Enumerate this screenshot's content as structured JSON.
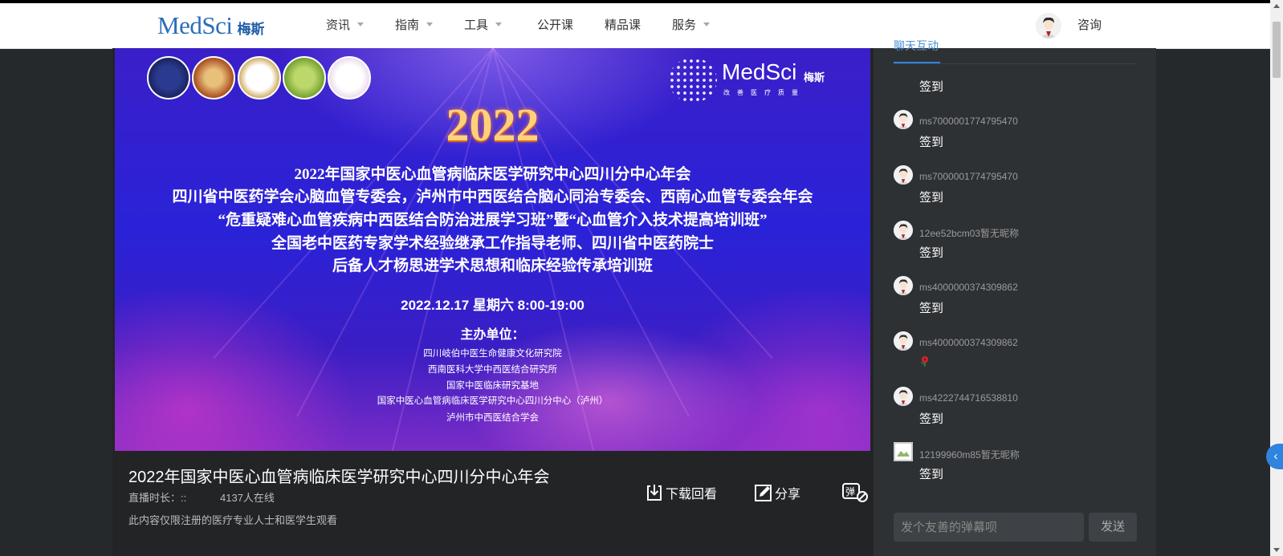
{
  "navbar": {
    "logo_en": "MedSci",
    "logo_zh": "梅斯",
    "items": [
      {
        "label": "资讯",
        "has_dropdown": true
      },
      {
        "label": "指南",
        "has_dropdown": true
      },
      {
        "label": "工具",
        "has_dropdown": true
      },
      {
        "label": "公开课",
        "has_dropdown": false
      },
      {
        "label": "精品课",
        "has_dropdown": false
      },
      {
        "label": "服务",
        "has_dropdown": true
      }
    ],
    "consult_label": "咨询"
  },
  "slide": {
    "brand_en": "MedSci",
    "brand_zh": "梅斯",
    "brand_slogan": "改善医疗质量",
    "year": "2022",
    "lines": [
      "2022年国家中医心血管病临床医学研究中心四川分中心年会",
      "四川省中医药学会心脑血管专委会，泸州市中西医结合脑心同治专委会、西南心血管专委会年会",
      "“危重疑难心血管疾病中西医结合防治进展学习班”暨“心血管介入技术提高培训班”",
      "全国老中医药专家学术经验继承工作指导老师、四川省中医药院士",
      "后备人才杨思进学术思想和临床经验传承培训班"
    ],
    "date": "2022.12.17 星期六 8:00-19:00",
    "host_title": "主办单位：",
    "organizers": [
      "四川岐伯中医生命健康文化研究院",
      "西南医科大学中西医结合研究所",
      "国家中医临床研究基地",
      "国家中医心血管病临床医学研究中心四川分中心（泸州）",
      "泸州市中西医结合学会"
    ]
  },
  "video": {
    "title": "2022年国家中医心血管病临床医学研究中心四川分中心年会",
    "duration_label": "直播时长：::",
    "online_count": "4137人在线",
    "notice": "此内容仅限注册的医疗专业人士和医学生观看",
    "actions": {
      "download": "下载回看",
      "share": "分享"
    }
  },
  "chat": {
    "tab_label": "聊天互动",
    "messages": [
      {
        "user": "",
        "text": "签到"
      },
      {
        "user": "ms7000001774795470",
        "text": "签到"
      },
      {
        "user": "ms7000001774795470",
        "text": "签到"
      },
      {
        "user": "12ee52bcm03暂无昵称",
        "text": "签到"
      },
      {
        "user": "ms4000000374309862",
        "text": "签到"
      },
      {
        "user": "ms4000000374309862",
        "text": ""
      },
      {
        "user": "ms4222744716538810",
        "text": "签到"
      },
      {
        "user": "12199960m85暂无昵称",
        "text": "签到"
      }
    ],
    "input_placeholder": "发个友善的弹幕呗",
    "send_label": "发送"
  },
  "colors": {
    "brand_blue": "#2a6eb8",
    "accent_blue": "#2f84e0",
    "page_bg": "#26292c",
    "chat_bg": "#2e3134"
  }
}
